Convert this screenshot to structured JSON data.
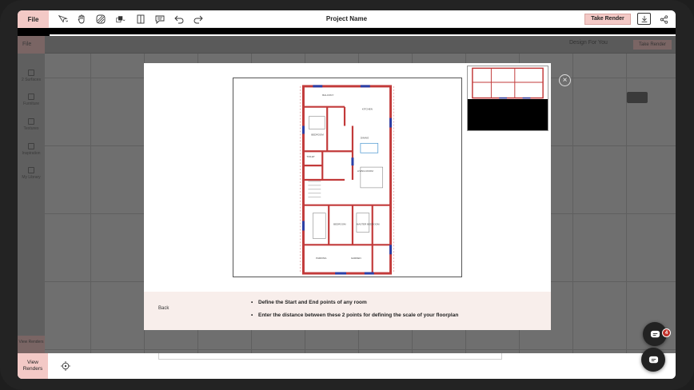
{
  "topbar": {
    "file_label": "File",
    "project_name": "Project Name",
    "take_render_label": "Take Render"
  },
  "ghost": {
    "file_label": "File",
    "brand_label": "Design For You",
    "take_render_label": "Take Render",
    "sidebar_items": [
      "2 Surfaces",
      "Furniture",
      "Textures",
      "Inspiration",
      "My Library"
    ],
    "view_renders_label": "View Renders"
  },
  "modal": {
    "back_label": "Back",
    "instructions": [
      "Define the Start and End points of any room",
      "Enter the distance between these 2 points for defining the scale of your floorplan"
    ],
    "plan_rooms": [
      "BALCONY",
      "KITCHEN",
      "BEDROOM",
      "TOILET",
      "LIVING ROOM",
      "DINING",
      "BEDROOM",
      "MASTER BEDROOM",
      "PARKING",
      "GARDEN"
    ]
  },
  "bottom": {
    "view_renders_label": "View\nRenders"
  },
  "chat": {
    "badge_count": "4"
  },
  "colors": {
    "accent": "#f3c9c6",
    "badge": "#c0312a",
    "wall": "#c23a3a",
    "wall_blue": "#2b3fa6"
  }
}
